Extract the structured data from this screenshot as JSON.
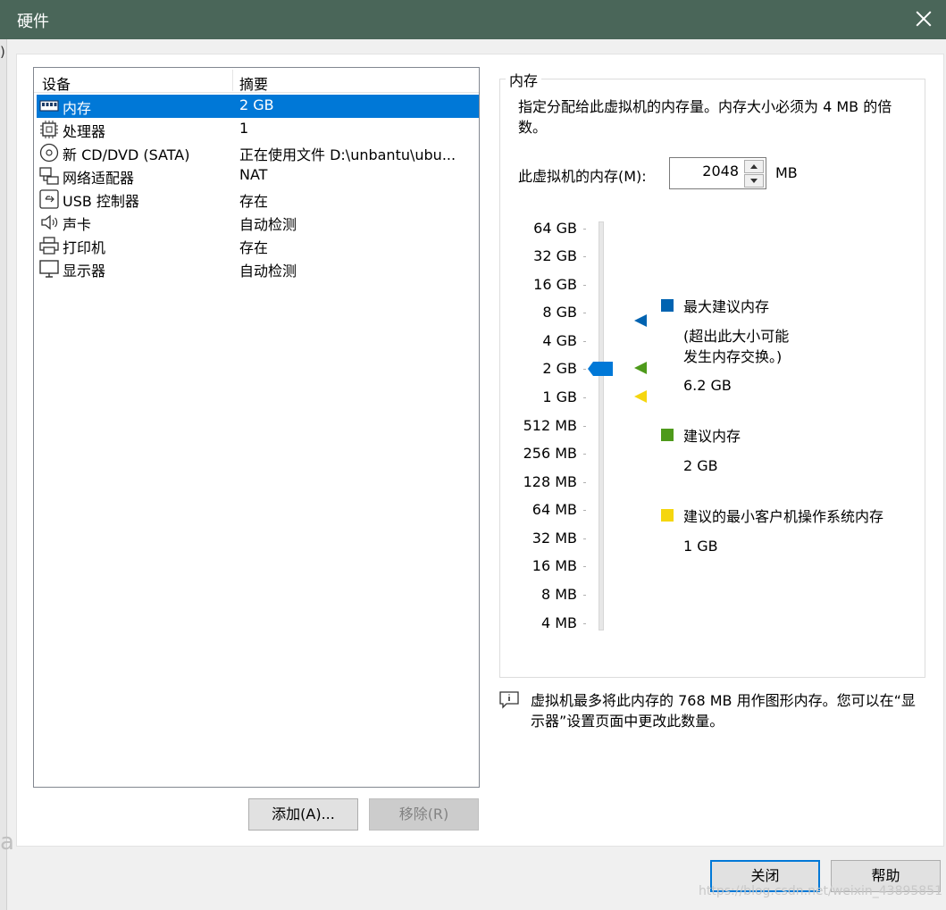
{
  "window": {
    "title": "硬件"
  },
  "edge": {
    "left_char": ")",
    "partial_char": "a"
  },
  "device_list": {
    "columns": {
      "device": "设备",
      "summary": "摘要"
    },
    "rows": [
      {
        "name": "内存",
        "summary": "2 GB",
        "icon": "memory-icon",
        "selected": true
      },
      {
        "name": "处理器",
        "summary": "1",
        "icon": "processor-icon"
      },
      {
        "name": "新 CD/DVD (SATA)",
        "summary": "正在使用文件 D:\\unbantu\\ubu...",
        "icon": "cd-dvd-icon"
      },
      {
        "name": "网络适配器",
        "summary": "NAT",
        "icon": "network-adapter-icon"
      },
      {
        "name": "USB 控制器",
        "summary": "存在",
        "icon": "usb-icon"
      },
      {
        "name": "声卡",
        "summary": "自动检测",
        "icon": "speaker-icon"
      },
      {
        "name": "打印机",
        "summary": "存在",
        "icon": "printer-icon"
      },
      {
        "name": "显示器",
        "summary": "自动检测",
        "icon": "monitor-icon"
      }
    ]
  },
  "buttons": {
    "add": "添加(A)...",
    "remove": "移除(R)",
    "close": "关闭",
    "help": "帮助"
  },
  "memory": {
    "group_title": "内存",
    "description": "指定分配给此虚拟机的内存量。内存大小必须为 4 MB 的倍数。",
    "field_label": "此虚拟机的内存(M):",
    "value": "2048",
    "unit": "MB",
    "scale": [
      "64 GB",
      "32 GB",
      "16 GB",
      "8 GB",
      "4 GB",
      "2 GB",
      "1 GB",
      "512 MB",
      "256 MB",
      "128 MB",
      "64 MB",
      "32 MB",
      "16 MB",
      "8 MB",
      "4 MB"
    ],
    "legend": {
      "max": {
        "title": "最大建议内存",
        "note1": "(超出此大小可能",
        "note2": "发生内存交换。)",
        "value": "6.2 GB",
        "color": "#0063b1"
      },
      "recommended": {
        "title": "建议内存",
        "value": "2 GB",
        "color": "#4e9a1b"
      },
      "min": {
        "title": "建议的最小客户机操作系统内存",
        "value": "1 GB",
        "color": "#f5d60f"
      }
    },
    "info": "虚拟机最多将此内存的 768 MB 用作图形内存。您可以在“显示器”设置页面中更改此数量。"
  },
  "watermark": "https://blog.csdn.net/weixin_43895851"
}
